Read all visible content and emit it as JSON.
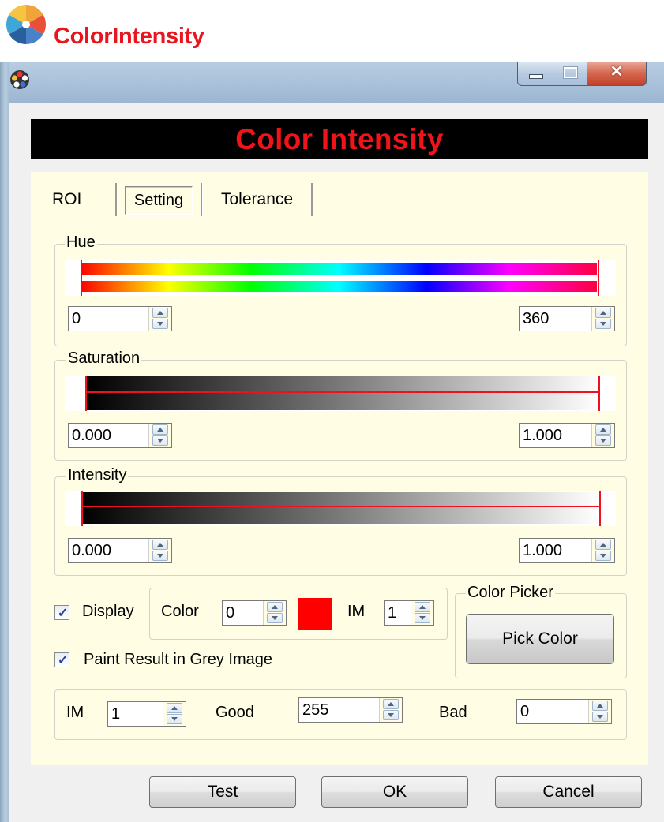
{
  "app": {
    "title": "ColorIntensity"
  },
  "window": {
    "banner": "Color Intensity"
  },
  "tabs": [
    {
      "label": "ROI",
      "active": false
    },
    {
      "label": "Setting",
      "active": true
    },
    {
      "label": "Tolerance",
      "active": false
    }
  ],
  "hue": {
    "label": "Hue",
    "min": "0",
    "max": "360"
  },
  "saturation": {
    "label": "Saturation",
    "min": "0.000",
    "max": "1.000"
  },
  "intensity": {
    "label": "Intensity",
    "min": "0.000",
    "max": "1.000"
  },
  "display": {
    "checkbox_label": "Display",
    "checked": true,
    "color_label": "Color",
    "color_value": "0",
    "swatch_color": "#ff0000",
    "im_label": "IM",
    "im_value": "1"
  },
  "paint_result": {
    "label": "Paint Result in Grey Image",
    "checked": true
  },
  "color_picker": {
    "label": "Color Picker",
    "button": "Pick Color"
  },
  "output": {
    "im_label": "IM",
    "im_value": "1",
    "good_label": "Good",
    "good_value": "255",
    "bad_label": "Bad",
    "bad_value": "0"
  },
  "buttons": {
    "test": "Test",
    "ok": "OK",
    "cancel": "Cancel"
  }
}
